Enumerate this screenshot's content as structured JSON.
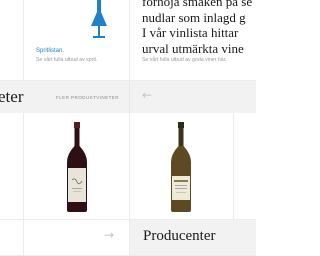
{
  "spirits_card": {
    "title": "Spritlistan.",
    "subtitle": "Se vårt fulla utbud av sprit.",
    "icon": "glass-icon",
    "accent_color": "#1d82c9"
  },
  "wine_intro": {
    "lines": [
      "förhöja smaken på se",
      "nudlar som inlagd g",
      "I vår vinlista hittar",
      "urval utmärkta vine"
    ],
    "subtitle": "Se vårt fulla utbud av goda viner här."
  },
  "products_section": {
    "title": "eter",
    "more_link": "FLER PRODUKTVINETER",
    "prev_icon": "arrow-left-icon",
    "next_icon": "arrow-right-icon"
  },
  "products": [
    {
      "name": "red-wine-bottle",
      "label_color": "#e9e4d8",
      "glass_color": "#3a1418"
    },
    {
      "name": "white-wine-bottle",
      "label_color": "#efe9d8",
      "glass_color": "#6b5528"
    }
  ],
  "producers": {
    "title": "Producenter"
  }
}
